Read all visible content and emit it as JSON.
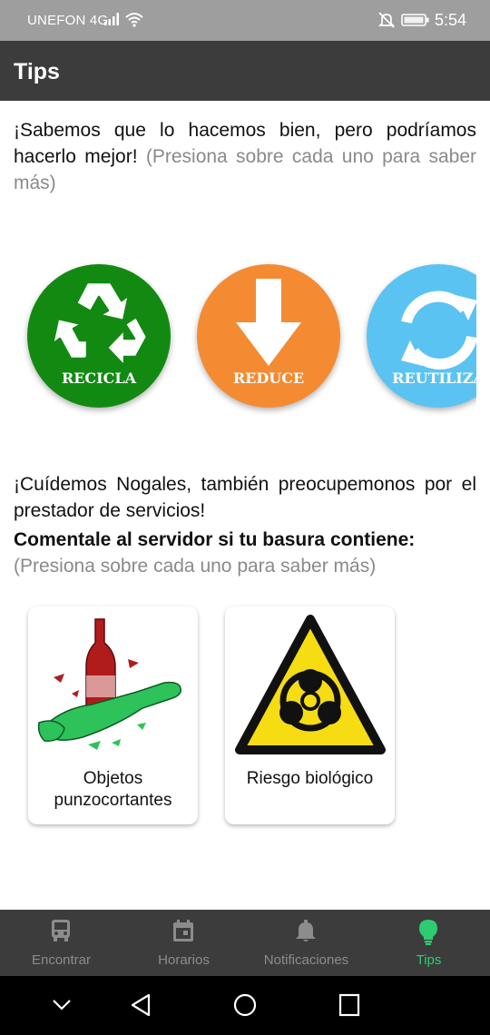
{
  "status_bar": {
    "carrier": "UNEFON 4G",
    "time": "5:54",
    "icons": [
      "signal-icon",
      "wifi-icon",
      "bell-off-icon",
      "battery-icon"
    ]
  },
  "app_bar": {
    "title": "Tips"
  },
  "intro": {
    "text": "¡Sabemos que lo hacemos bien, pero podríamos hacerlo mejor! ",
    "hint": "(Presiona sobre cada uno para saber más)"
  },
  "actions": [
    {
      "label": "RECICLA",
      "color": "#128a12",
      "icon": "recycle-icon"
    },
    {
      "label": "REDUCE",
      "color": "#f48b32",
      "icon": "arrow-down-icon"
    },
    {
      "label": "REUTILIZA",
      "color": "#5bc3f2",
      "icon": "refresh-icon"
    }
  ],
  "care": {
    "text": "¡Cuídemos Nogales, también preocupemonos por el prestador de servicios!",
    "bold": "Comentale al servidor si tu basura contiene:",
    "hint": "(Presiona sobre cada uno para saber más)"
  },
  "cards": [
    {
      "label": "Objetos punzocortantes",
      "icon": "broken-glass-icon"
    },
    {
      "label": "Riesgo biológico",
      "icon": "biohazard-icon"
    }
  ],
  "bottom_nav": [
    {
      "label": "Encontrar",
      "icon": "bus-icon",
      "active": false
    },
    {
      "label": "Horarios",
      "icon": "calendar-icon",
      "active": false
    },
    {
      "label": "Notificaciones",
      "icon": "bell-icon",
      "active": false
    },
    {
      "label": "Tips",
      "icon": "lightbulb-icon",
      "active": true
    }
  ],
  "colors": {
    "active": "#2ecc71",
    "inactive": "#8c8c8c",
    "app_bar": "#3c3c3c"
  }
}
